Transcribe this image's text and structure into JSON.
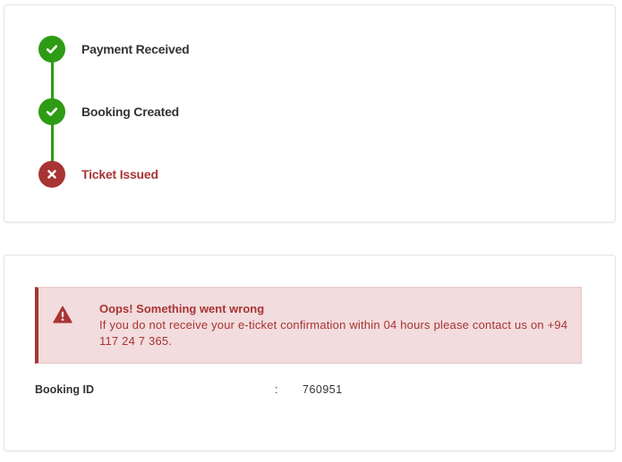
{
  "steps": [
    {
      "label": "Payment Received",
      "state": "success",
      "icon": "check-icon"
    },
    {
      "label": "Booking Created",
      "state": "success",
      "icon": "check-icon"
    },
    {
      "label": "Ticket Issued",
      "state": "error",
      "icon": "close-icon"
    }
  ],
  "alert": {
    "icon": "warning-icon",
    "title": "Oops! Something went wrong",
    "message": "If you do not receive your e-ticket confirmation within 04 hours please contact us on +94 117 24 7 365."
  },
  "booking": {
    "label": "Booking ID",
    "separator": ":",
    "value": "760951"
  },
  "colors": {
    "success": "#2e9b15",
    "error": "#a83434",
    "alert_background": "#f2dcdd"
  }
}
